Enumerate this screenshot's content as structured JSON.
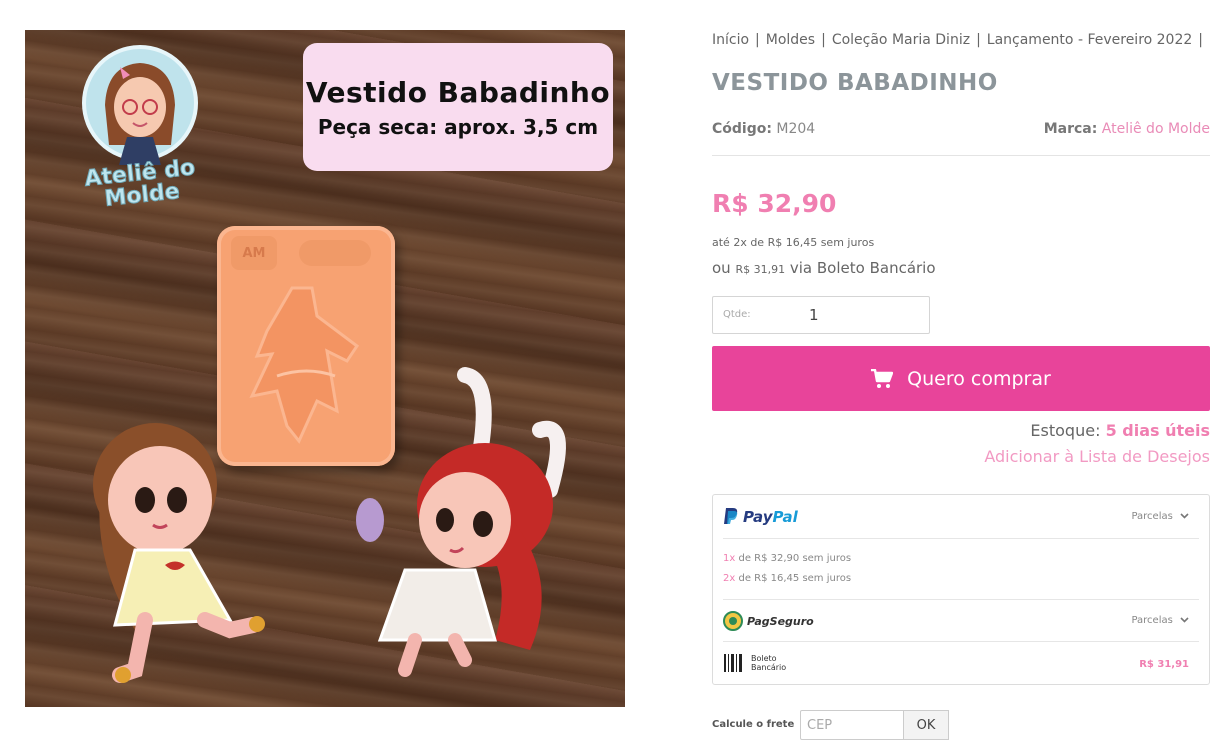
{
  "breadcrumb": [
    "Início",
    "Moldes",
    "Coleção Maria Diniz",
    "Lançamento - Fevereiro 2022"
  ],
  "photo": {
    "caption_title": "Vestido Babadinho",
    "caption_subtitle": "Peça seca: aprox. 3,5 cm",
    "logo_text": "Ateliê do Molde",
    "mold_label": "AM"
  },
  "product": {
    "title": "VESTIDO BABADINHO",
    "code_label": "Código:",
    "code_value": "M204",
    "brand_label": "Marca:",
    "brand_value": "Ateliê do Molde",
    "price": "R$ 32,90",
    "installments": "até 2x de R$ 16,45 sem juros",
    "boleto_prefix": "ou",
    "boleto_price": "R$ 31,91",
    "boleto_suffix": "via Boleto Bancário",
    "qty_label": "Qtde:",
    "qty_value": "1",
    "buy_label": "Quero comprar",
    "stock_label": "Estoque:",
    "stock_value": "5 dias úteis",
    "wishlist_label": "Adicionar à Lista de Desejos"
  },
  "payments": {
    "paypal": {
      "name_part1": "Pay",
      "name_part2": "Pal",
      "parcelas": "Parcelas",
      "lines": [
        {
          "n": "1x",
          "text": "de R$ 32,90 sem juros"
        },
        {
          "n": "2x",
          "text": "de R$ 16,45 sem juros"
        }
      ]
    },
    "pagseguro": {
      "name": "PagSeguro",
      "parcelas": "Parcelas"
    },
    "boleto": {
      "line1": "Boleto",
      "line2": "Bancário",
      "price": "R$ 31,91"
    }
  },
  "shipping": {
    "label": "Calcule o frete",
    "cep_placeholder": "CEP",
    "ok_label": "OK"
  },
  "colors": {
    "accent": "#e8449a",
    "price": "#f07fb1",
    "title": "#8c959a"
  }
}
